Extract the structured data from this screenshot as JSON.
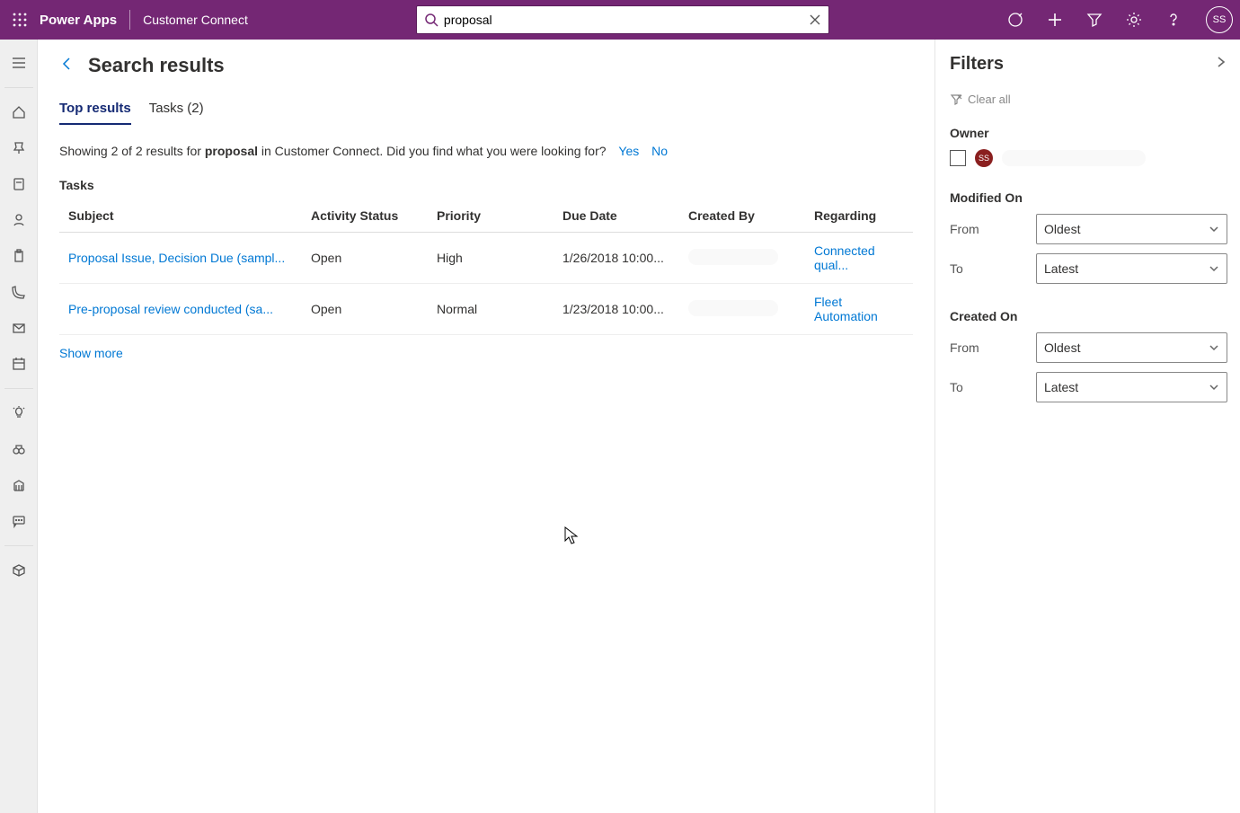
{
  "header": {
    "brand": "Power Apps",
    "app_name": "Customer Connect",
    "search_value": "proposal",
    "avatar": "SS"
  },
  "page": {
    "title": "Search results",
    "tabs": [
      {
        "label": "Top results",
        "active": true
      },
      {
        "label": "Tasks (2)",
        "active": false
      }
    ],
    "summary_prefix": "Showing 2 of 2 results for ",
    "summary_term": "proposal",
    "summary_suffix": " in Customer Connect. Did you find what you were looking for?",
    "summary_yes": "Yes",
    "summary_no": "No",
    "section": "Tasks",
    "columns": [
      "Subject",
      "Activity Status",
      "Priority",
      "Due Date",
      "Created By",
      "Regarding"
    ],
    "rows": [
      {
        "subject": "Proposal Issue, Decision Due (sampl...",
        "status": "Open",
        "priority": "High",
        "due": "1/26/2018 10:00...",
        "regarding": "Connected qual..."
      },
      {
        "subject": "Pre-proposal review conducted (sa...",
        "status": "Open",
        "priority": "Normal",
        "due": "1/23/2018 10:00...",
        "regarding": "Fleet Automation"
      }
    ],
    "show_more": "Show more"
  },
  "filters": {
    "title": "Filters",
    "clear": "Clear all",
    "owner_label": "Owner",
    "owner_badge": "SS",
    "modified_label": "Modified On",
    "created_label": "Created On",
    "from_label": "From",
    "to_label": "To",
    "oldest": "Oldest",
    "latest": "Latest"
  }
}
